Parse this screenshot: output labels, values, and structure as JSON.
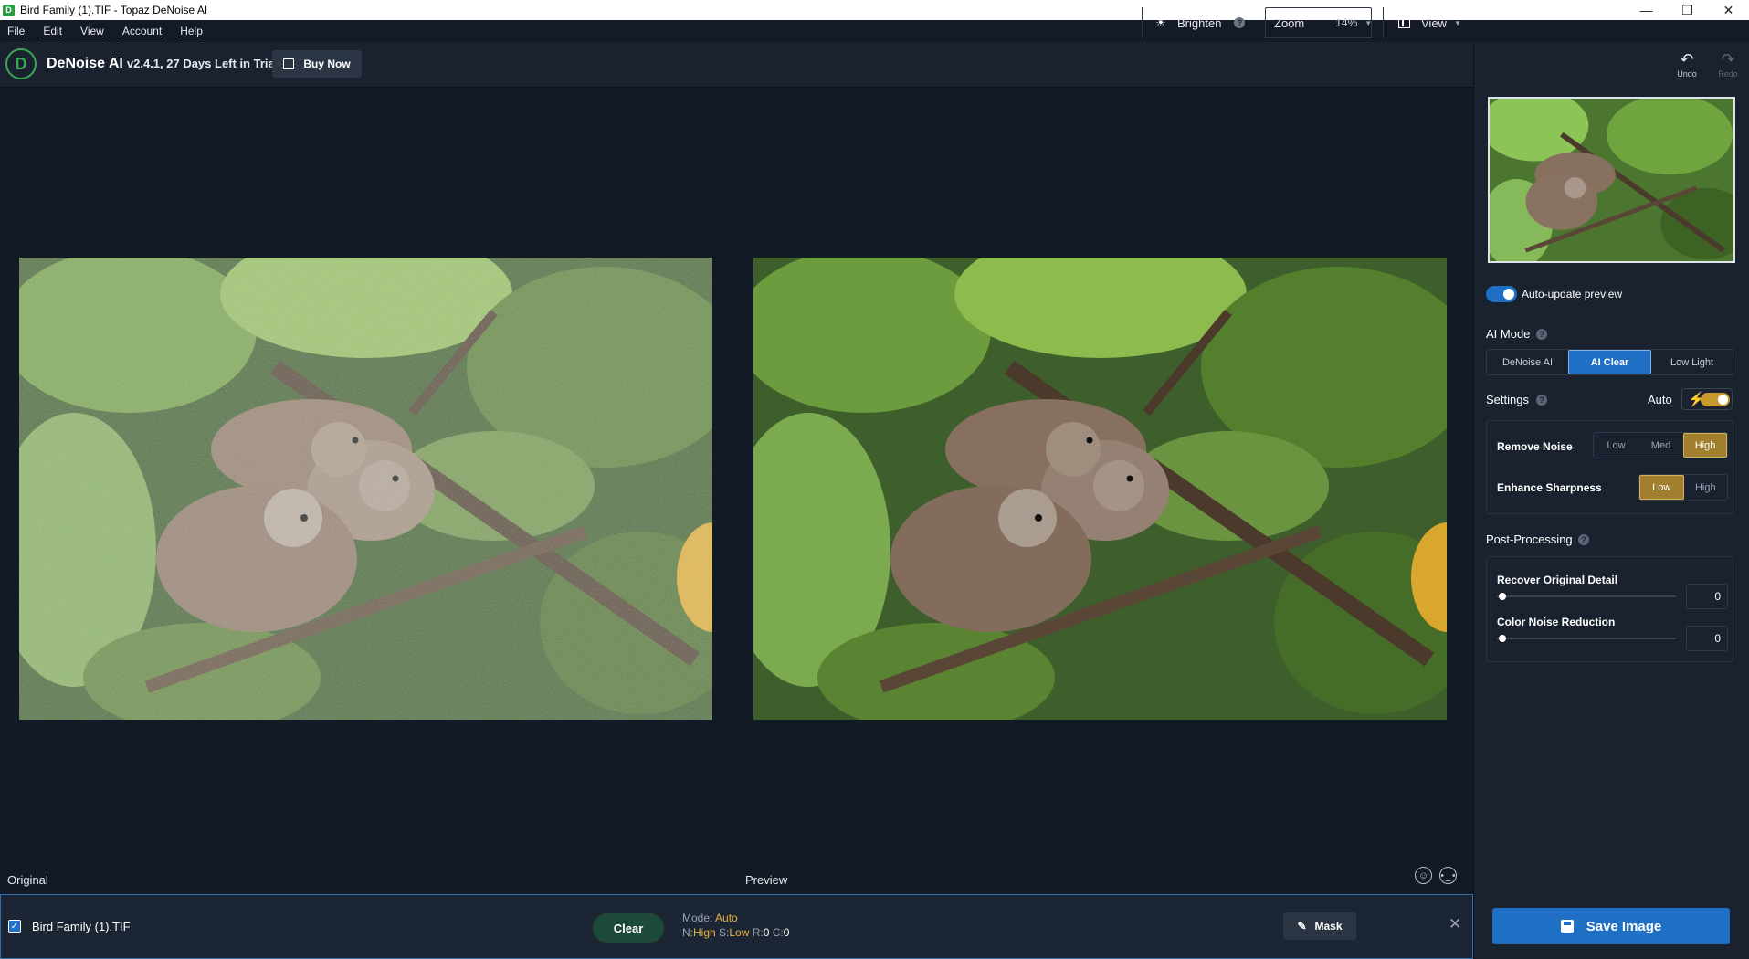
{
  "window": {
    "title": "Bird Family (1).TIF - Topaz DeNoise AI",
    "controls": [
      "—",
      "❐",
      "✕"
    ]
  },
  "menu": [
    "File",
    "Edit",
    "View",
    "Account",
    "Help"
  ],
  "toolbar": {
    "app_name": "DeNoise AI",
    "version_info": "v2.4.1, 27 Days Left in Trial",
    "buy_label": "Buy Now",
    "brighten_label": "Brighten",
    "zoom_label": "Zoom",
    "zoom_value": "14%",
    "view_label": "View",
    "undo_label": "Undo",
    "redo_label": "Redo"
  },
  "canvas": {
    "original_label": "Original",
    "preview_label": "Preview"
  },
  "file_strip": {
    "filename": "Bird Family (1).TIF",
    "checked": true,
    "clear_label": "Clear",
    "mode_key": "Mode:",
    "mode_value": "Auto",
    "n_key": "N:",
    "n_value": "High",
    "s_key": "S:",
    "s_value": "Low",
    "r_key": "R:",
    "r_value": "0",
    "c_key": "C:",
    "c_value": "0",
    "mask_label": "Mask",
    "close_label": "✕"
  },
  "right_panel": {
    "auto_update_label": "Auto-update preview",
    "auto_update_on": true,
    "ai_mode_title": "AI Mode",
    "ai_modes": [
      "DeNoise AI",
      "AI Clear",
      "Low Light"
    ],
    "ai_mode_selected": "AI Clear",
    "settings_title": "Settings",
    "auto_label": "Auto",
    "auto_on": true,
    "remove_noise_label": "Remove Noise",
    "remove_noise_options": [
      "Low",
      "Med",
      "High"
    ],
    "remove_noise_selected": "High",
    "enhance_sharpness_label": "Enhance Sharpness",
    "enhance_sharpness_options": [
      "Low",
      "High"
    ],
    "enhance_sharpness_selected": "Low",
    "post_processing_title": "Post-Processing",
    "recover_detail_label": "Recover Original Detail",
    "recover_detail_value": "0",
    "color_noise_label": "Color Noise Reduction",
    "color_noise_value": "0",
    "save_label": "Save Image"
  },
  "colors": {
    "accent_blue": "#1f6fc4",
    "gold": "#e8b33a",
    "brand_green": "#39a852"
  }
}
